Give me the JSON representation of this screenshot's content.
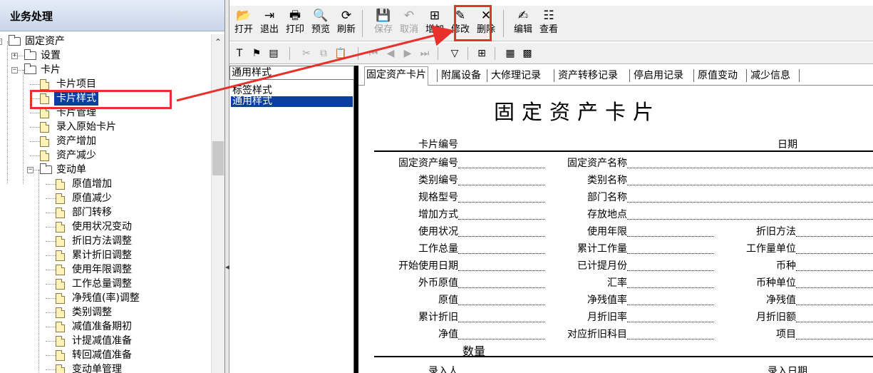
{
  "left_panel": {
    "title": "业务处理"
  },
  "tree": [
    {
      "label": "固定资产",
      "type": "folder",
      "pm": "−"
    },
    {
      "label": "设置",
      "type": "folder",
      "pm": "+"
    },
    {
      "label": "卡片",
      "type": "folder",
      "pm": "−"
    },
    {
      "label": "卡片项目",
      "type": "doc"
    },
    {
      "label": "卡片样式",
      "type": "doc",
      "selected": true
    },
    {
      "label": "卡片管理",
      "type": "doc"
    },
    {
      "label": "录入原始卡片",
      "type": "doc"
    },
    {
      "label": "资产增加",
      "type": "doc"
    },
    {
      "label": "资产减少",
      "type": "doc"
    },
    {
      "label": "变动单",
      "type": "folder",
      "pm": "−"
    },
    {
      "label": "原值增加",
      "type": "doc"
    },
    {
      "label": "原值减少",
      "type": "doc"
    },
    {
      "label": "部门转移",
      "type": "doc"
    },
    {
      "label": "使用状况变动",
      "type": "doc"
    },
    {
      "label": "折旧方法调整",
      "type": "doc"
    },
    {
      "label": "累计折旧调整",
      "type": "doc"
    },
    {
      "label": "使用年限调整",
      "type": "doc"
    },
    {
      "label": "工作总量调整",
      "type": "doc"
    },
    {
      "label": "净残值(率)调整",
      "type": "doc"
    },
    {
      "label": "类别调整",
      "type": "doc"
    },
    {
      "label": "减值准备期初",
      "type": "doc"
    },
    {
      "label": "计提减值准备",
      "type": "doc"
    },
    {
      "label": "转回减值准备",
      "type": "doc"
    },
    {
      "label": "变动单管理",
      "type": "doc"
    }
  ],
  "toolbar": {
    "buttons": [
      {
        "label": "打开",
        "icon": "open-icon",
        "glyph": "📂"
      },
      {
        "label": "退出",
        "icon": "exit-icon",
        "glyph": "⇥"
      },
      {
        "label": "打印",
        "icon": "print-icon",
        "glyph": "🖶"
      },
      {
        "label": "预览",
        "icon": "preview-icon",
        "glyph": "🔍"
      },
      {
        "label": "刷新",
        "icon": "refresh-icon",
        "glyph": "⟳"
      },
      {
        "label": "保存",
        "icon": "save-icon",
        "glyph": "💾",
        "disabled": true
      },
      {
        "label": "取消",
        "icon": "cancel-icon",
        "glyph": "↶",
        "disabled": true
      },
      {
        "label": "增加",
        "icon": "add-icon",
        "glyph": "⊞"
      },
      {
        "label": "修改",
        "icon": "modify-icon",
        "glyph": "✎"
      },
      {
        "label": "删除",
        "icon": "delete-icon",
        "glyph": "✕"
      },
      {
        "label": "编辑",
        "icon": "edit-icon",
        "glyph": "✍"
      },
      {
        "label": "查看",
        "icon": "view-icon",
        "glyph": "☷"
      }
    ],
    "small_icons": [
      {
        "name": "text-tool-icon",
        "glyph": "T"
      },
      {
        "name": "flag-icon",
        "glyph": "⚑"
      },
      {
        "name": "form-icon",
        "glyph": "▤"
      },
      {
        "name": "cut-icon",
        "glyph": "✂",
        "disabled": true
      },
      {
        "name": "copy-icon",
        "glyph": "⧉",
        "disabled": true
      },
      {
        "name": "paste-icon",
        "glyph": "📋",
        "disabled": true
      },
      {
        "name": "first-record-icon",
        "glyph": "⏮",
        "disabled": true
      },
      {
        "name": "prev-record-icon",
        "glyph": "◀",
        "disabled": true
      },
      {
        "name": "next-record-icon",
        "glyph": "▶",
        "disabled": true
      },
      {
        "name": "last-record-icon",
        "glyph": "⏭",
        "disabled": true
      },
      {
        "name": "filter-icon",
        "glyph": "▽"
      },
      {
        "name": "grid-view-icon",
        "glyph": "⊞"
      },
      {
        "name": "calculator-icon",
        "glyph": "▦"
      },
      {
        "name": "chart-icon",
        "glyph": "▩"
      }
    ]
  },
  "style_panel": {
    "combo_value": "通用样式",
    "items": [
      {
        "label": "标签样式"
      },
      {
        "label": "通用样式",
        "selected": true
      }
    ]
  },
  "tabs": [
    "固定资产卡片",
    "附属设备",
    "大修理记录",
    "资产转移记录",
    "停启用记录",
    "原值变动",
    "减少信息"
  ],
  "card": {
    "title": "固定资产卡片",
    "card_no_label": "卡片编号",
    "date_label": "日期",
    "quantity_label": "数量",
    "entry_person_label": "录入人",
    "entry_date_label": "录入日期",
    "rows": [
      [
        "固定资产编号",
        "固定资产名称",
        ""
      ],
      [
        "类别编号",
        "类别名称",
        ""
      ],
      [
        "规格型号",
        "部门名称",
        ""
      ],
      [
        "增加方式",
        "存放地点",
        ""
      ],
      [
        "使用状况",
        "使用年限",
        "折旧方法"
      ],
      [
        "工作总量",
        "累计工作量",
        "工作量单位"
      ],
      [
        "开始使用日期",
        "已计提月份",
        "币种"
      ],
      [
        "外币原值",
        "汇率",
        "币种单位"
      ],
      [
        "原值",
        "净残值率",
        "净残值"
      ],
      [
        "累计折旧",
        "月折旧率",
        "月折旧额"
      ],
      [
        "净值",
        "对应折旧科目",
        "项目"
      ]
    ]
  },
  "colors": {
    "highlight": "#e8312b",
    "selection": "#0a3fa0"
  }
}
